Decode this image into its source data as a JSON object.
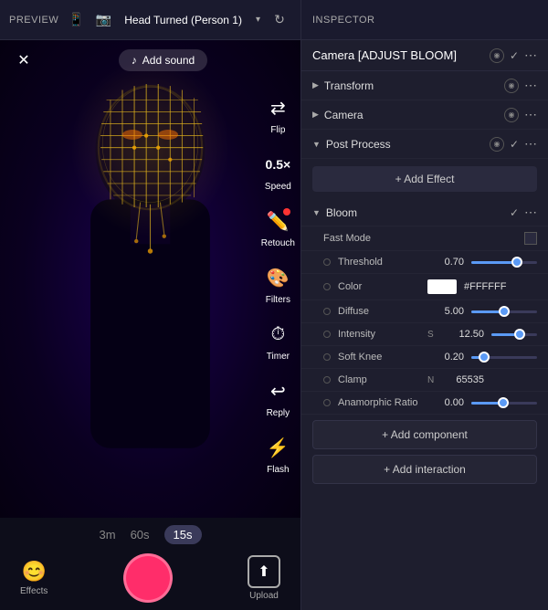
{
  "topbar": {
    "preview_label": "PREVIEW",
    "inspector_label": "INSPECTOR",
    "head_turned": "Head Turned (Person 1)",
    "camera_adjust": "Camera [ADJUST BLOOM]"
  },
  "toolbar": {
    "add_sound": "Add sound",
    "flip": "Flip",
    "speed": "0.5x\nSpeed",
    "retouch": "Retouch",
    "filters": "Filters",
    "timer": "Timer",
    "reply": "Reply",
    "flash": "Flash"
  },
  "preview_bottom": {
    "time_options": [
      "3m",
      "60s",
      "15s"
    ],
    "active_time": "15s",
    "effects_label": "Effects",
    "upload_label": "Upload"
  },
  "inspector": {
    "sections": [
      {
        "name": "Transform",
        "chevron": "▶"
      },
      {
        "name": "Camera",
        "chevron": "▶"
      },
      {
        "name": "Post Process",
        "chevron": "▼"
      }
    ],
    "add_effect_label": "+ Add Effect",
    "bloom": {
      "name": "Bloom",
      "fast_mode_label": "Fast Mode",
      "properties": [
        {
          "name": "Threshold",
          "value": "0.70",
          "prefix": "",
          "fill_pct": 70,
          "thumb_pct": 70,
          "has_slider": true
        },
        {
          "name": "Color",
          "value": "#FFFFFF",
          "is_color": true
        },
        {
          "name": "Diffuse",
          "value": "5.00",
          "prefix": "",
          "fill_pct": 50,
          "thumb_pct": 50,
          "has_slider": true
        },
        {
          "name": "Intensity",
          "value": "12.50",
          "prefix": "S",
          "fill_pct": 62,
          "thumb_pct": 62,
          "has_slider": true
        },
        {
          "name": "Soft Knee",
          "value": "0.20",
          "prefix": "",
          "fill_pct": 20,
          "thumb_pct": 20,
          "has_slider": true
        },
        {
          "name": "Clamp",
          "value": "65535",
          "prefix": "N",
          "fill_pct": 0,
          "thumb_pct": 0,
          "has_slider": false
        },
        {
          "name": "Anamorphic Ratio",
          "value": "0.00",
          "prefix": "",
          "fill_pct": 48,
          "thumb_pct": 48,
          "has_slider": true
        }
      ]
    },
    "add_component_label": "+ Add component",
    "add_interaction_label": "+ Add interaction"
  }
}
